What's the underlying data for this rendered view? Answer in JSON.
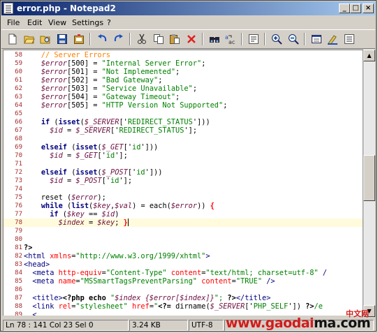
{
  "window": {
    "title": "error.php - Notepad2"
  },
  "menu": [
    "File",
    "Edit",
    "View",
    "Settings",
    "?"
  ],
  "toolbar_icons": [
    "new-icon",
    "open-icon",
    "browse-icon",
    "save-icon",
    "save-copy-icon",
    "undo-icon",
    "redo-icon",
    "cut-icon",
    "copy-icon",
    "paste-icon",
    "delete-icon",
    "find-icon",
    "replace-icon",
    "word-wrap-icon",
    "zoom-in-icon",
    "zoom-out-icon",
    "scheme-icon",
    "customize-icon",
    "exit-icon"
  ],
  "code_lines": [
    {
      "n": "58",
      "segs": [
        {
          "t": "    // Server Errors",
          "c": "#ff8000"
        }
      ]
    },
    {
      "n": "59",
      "segs": [
        {
          "t": "    ",
          "c": "#000"
        },
        {
          "t": "$error",
          "c": "#6d1040",
          "i": true
        },
        {
          "t": "[500] = ",
          "c": "#000"
        },
        {
          "t": "\"Internal Server Error\"",
          "c": "#008000"
        },
        {
          "t": ";",
          "c": "#000"
        }
      ]
    },
    {
      "n": "60",
      "segs": [
        {
          "t": "    ",
          "c": "#000"
        },
        {
          "t": "$error",
          "c": "#6d1040",
          "i": true
        },
        {
          "t": "[501] = ",
          "c": "#000"
        },
        {
          "t": "\"Not Implemented\"",
          "c": "#008000"
        },
        {
          "t": ";",
          "c": "#000"
        }
      ]
    },
    {
      "n": "61",
      "segs": [
        {
          "t": "    ",
          "c": "#000"
        },
        {
          "t": "$error",
          "c": "#6d1040",
          "i": true
        },
        {
          "t": "[502] = ",
          "c": "#000"
        },
        {
          "t": "\"Bad Gateway\"",
          "c": "#008000"
        },
        {
          "t": ";",
          "c": "#000"
        }
      ]
    },
    {
      "n": "62",
      "segs": [
        {
          "t": "    ",
          "c": "#000"
        },
        {
          "t": "$error",
          "c": "#6d1040",
          "i": true
        },
        {
          "t": "[503] = ",
          "c": "#000"
        },
        {
          "t": "\"Service Unavailable\"",
          "c": "#008000"
        },
        {
          "t": ";",
          "c": "#000"
        }
      ]
    },
    {
      "n": "63",
      "segs": [
        {
          "t": "    ",
          "c": "#000"
        },
        {
          "t": "$error",
          "c": "#6d1040",
          "i": true
        },
        {
          "t": "[504] = ",
          "c": "#000"
        },
        {
          "t": "\"Gateway Timeout\"",
          "c": "#008000"
        },
        {
          "t": ";",
          "c": "#000"
        }
      ]
    },
    {
      "n": "64",
      "segs": [
        {
          "t": "    ",
          "c": "#000"
        },
        {
          "t": "$error",
          "c": "#6d1040",
          "i": true
        },
        {
          "t": "[505] = ",
          "c": "#000"
        },
        {
          "t": "\"HTTP Version Not Supported\"",
          "c": "#008000"
        },
        {
          "t": ";",
          "c": "#000"
        }
      ]
    },
    {
      "n": "65",
      "segs": []
    },
    {
      "n": "66",
      "segs": [
        {
          "t": "    ",
          "c": "#000"
        },
        {
          "t": "if",
          "c": "#000080",
          "b": true
        },
        {
          "t": " (",
          "c": "#000"
        },
        {
          "t": "isset",
          "c": "#000080",
          "b": true
        },
        {
          "t": "(",
          "c": "#000"
        },
        {
          "t": "$_SERVER",
          "c": "#6d1040",
          "i": true
        },
        {
          "t": "['",
          "c": "#000"
        },
        {
          "t": "REDIRECT_STATUS",
          "c": "#008000"
        },
        {
          "t": "']))",
          "c": "#000"
        }
      ]
    },
    {
      "n": "67",
      "segs": [
        {
          "t": "      ",
          "c": "#000"
        },
        {
          "t": "$id",
          "c": "#6d1040",
          "i": true
        },
        {
          "t": " = ",
          "c": "#000"
        },
        {
          "t": "$_SERVER",
          "c": "#6d1040",
          "i": true
        },
        {
          "t": "['",
          "c": "#000"
        },
        {
          "t": "REDIRECT_STATUS",
          "c": "#008000"
        },
        {
          "t": "'];",
          "c": "#000"
        }
      ]
    },
    {
      "n": "68",
      "segs": []
    },
    {
      "n": "69",
      "segs": [
        {
          "t": "    ",
          "c": "#000"
        },
        {
          "t": "elseif",
          "c": "#000080",
          "b": true
        },
        {
          "t": " (",
          "c": "#000"
        },
        {
          "t": "isset",
          "c": "#000080",
          "b": true
        },
        {
          "t": "(",
          "c": "#000"
        },
        {
          "t": "$_GET",
          "c": "#6d1040",
          "i": true
        },
        {
          "t": "['",
          "c": "#000"
        },
        {
          "t": "id",
          "c": "#008000"
        },
        {
          "t": "']))",
          "c": "#000"
        }
      ]
    },
    {
      "n": "70",
      "segs": [
        {
          "t": "      ",
          "c": "#000"
        },
        {
          "t": "$id",
          "c": "#6d1040",
          "i": true
        },
        {
          "t": " = ",
          "c": "#000"
        },
        {
          "t": "$_GET",
          "c": "#6d1040",
          "i": true
        },
        {
          "t": "['",
          "c": "#000"
        },
        {
          "t": "id",
          "c": "#008000"
        },
        {
          "t": "'];",
          "c": "#000"
        }
      ]
    },
    {
      "n": "71",
      "segs": []
    },
    {
      "n": "72",
      "segs": [
        {
          "t": "    ",
          "c": "#000"
        },
        {
          "t": "elseif",
          "c": "#000080",
          "b": true
        },
        {
          "t": " (",
          "c": "#000"
        },
        {
          "t": "isset",
          "c": "#000080",
          "b": true
        },
        {
          "t": "(",
          "c": "#000"
        },
        {
          "t": "$_POST",
          "c": "#6d1040",
          "i": true
        },
        {
          "t": "['",
          "c": "#000"
        },
        {
          "t": "id",
          "c": "#008000"
        },
        {
          "t": "']))",
          "c": "#000"
        }
      ]
    },
    {
      "n": "73",
      "segs": [
        {
          "t": "      ",
          "c": "#000"
        },
        {
          "t": "$id",
          "c": "#6d1040",
          "i": true
        },
        {
          "t": " = ",
          "c": "#000"
        },
        {
          "t": "$_POST",
          "c": "#6d1040",
          "i": true
        },
        {
          "t": "['",
          "c": "#000"
        },
        {
          "t": "id",
          "c": "#008000"
        },
        {
          "t": "'];",
          "c": "#000"
        }
      ]
    },
    {
      "n": "74",
      "segs": []
    },
    {
      "n": "75",
      "segs": [
        {
          "t": "    reset (",
          "c": "#000"
        },
        {
          "t": "$error",
          "c": "#6d1040",
          "i": true
        },
        {
          "t": ");",
          "c": "#000"
        }
      ]
    },
    {
      "n": "76",
      "segs": [
        {
          "t": "    ",
          "c": "#000"
        },
        {
          "t": "while",
          "c": "#000080",
          "b": true
        },
        {
          "t": " (",
          "c": "#000"
        },
        {
          "t": "list",
          "c": "#000080",
          "b": true
        },
        {
          "t": "(",
          "c": "#000"
        },
        {
          "t": "$key",
          "c": "#6d1040",
          "i": true
        },
        {
          "t": ",",
          "c": "#000"
        },
        {
          "t": "$val",
          "c": "#6d1040",
          "i": true
        },
        {
          "t": ") = each(",
          "c": "#000"
        },
        {
          "t": "$error",
          "c": "#6d1040",
          "i": true
        },
        {
          "t": ")) ",
          "c": "#000"
        },
        {
          "t": "{",
          "c": "#ff0000",
          "b": true
        }
      ]
    },
    {
      "n": "77",
      "segs": [
        {
          "t": "      ",
          "c": "#000"
        },
        {
          "t": "if",
          "c": "#000080",
          "b": true
        },
        {
          "t": " (",
          "c": "#000"
        },
        {
          "t": "$key",
          "c": "#6d1040",
          "i": true
        },
        {
          "t": " == ",
          "c": "#000"
        },
        {
          "t": "$id",
          "c": "#6d1040",
          "i": true
        },
        {
          "t": ")",
          "c": "#000"
        }
      ]
    },
    {
      "n": "78",
      "cur": true,
      "segs": [
        {
          "t": "        ",
          "c": "#000"
        },
        {
          "t": "$index",
          "c": "#6d1040",
          "i": true
        },
        {
          "t": " = ",
          "c": "#000"
        },
        {
          "t": "$key",
          "c": "#6d1040",
          "i": true
        },
        {
          "t": "; ",
          "c": "#000"
        },
        {
          "t": "}",
          "c": "#ff0000",
          "b": true
        }
      ]
    },
    {
      "n": "79",
      "segs": []
    },
    {
      "n": "80",
      "segs": []
    },
    {
      "n": "81",
      "segs": [
        {
          "t": "?>",
          "c": "#000",
          "b": true
        }
      ]
    },
    {
      "n": "82",
      "segs": [
        {
          "t": "<html ",
          "c": "#000080"
        },
        {
          "t": "xmlns",
          "c": "#ff0000"
        },
        {
          "t": "=",
          "c": "#000"
        },
        {
          "t": "\"http://www.w3.org/1999/xhtml\"",
          "c": "#008000"
        },
        {
          "t": ">",
          "c": "#000080"
        }
      ]
    },
    {
      "n": "83",
      "segs": [
        {
          "t": "<head>",
          "c": "#000080"
        }
      ]
    },
    {
      "n": "84",
      "segs": [
        {
          "t": "  <meta ",
          "c": "#000080"
        },
        {
          "t": "http-equiv",
          "c": "#ff0000"
        },
        {
          "t": "=",
          "c": "#000"
        },
        {
          "t": "\"Content-Type\"",
          "c": "#008000"
        },
        {
          "t": " ",
          "c": "#000"
        },
        {
          "t": "content",
          "c": "#ff0000"
        },
        {
          "t": "=",
          "c": "#000"
        },
        {
          "t": "\"text/html; charset=utf-8\"",
          "c": "#008000"
        },
        {
          "t": " /",
          "c": "#000080"
        }
      ]
    },
    {
      "n": "85",
      "segs": [
        {
          "t": "  <meta ",
          "c": "#000080"
        },
        {
          "t": "name",
          "c": "#ff0000"
        },
        {
          "t": "=",
          "c": "#000"
        },
        {
          "t": "\"MSSmartTagsPreventParsing\"",
          "c": "#008000"
        },
        {
          "t": " ",
          "c": "#000"
        },
        {
          "t": "content",
          "c": "#ff0000"
        },
        {
          "t": "=",
          "c": "#000"
        },
        {
          "t": "\"TRUE\"",
          "c": "#008000"
        },
        {
          "t": " />",
          "c": "#000080"
        }
      ]
    },
    {
      "n": "86",
      "segs": []
    },
    {
      "n": "87",
      "segs": [
        {
          "t": "  <title>",
          "c": "#000080"
        },
        {
          "t": "<?php echo ",
          "c": "#000",
          "b": true
        },
        {
          "t": "\"",
          "c": "#008000"
        },
        {
          "t": "$index {$error[$index]}",
          "c": "#6d1040",
          "i": true
        },
        {
          "t": "\";",
          "c": "#008000"
        },
        {
          "t": " ?>",
          "c": "#000",
          "b": true
        },
        {
          "t": "</title>",
          "c": "#000080"
        }
      ]
    },
    {
      "n": "88",
      "segs": [
        {
          "t": "  <link ",
          "c": "#000080"
        },
        {
          "t": "rel",
          "c": "#ff0000"
        },
        {
          "t": "=",
          "c": "#000"
        },
        {
          "t": "\"stylesheet\"",
          "c": "#008000"
        },
        {
          "t": " ",
          "c": "#000"
        },
        {
          "t": "href",
          "c": "#ff0000"
        },
        {
          "t": "=",
          "c": "#000"
        },
        {
          "t": "\"",
          "c": "#008000"
        },
        {
          "t": "<?= ",
          "c": "#000",
          "b": true
        },
        {
          "t": "dirname(",
          "c": "#000"
        },
        {
          "t": "$_SERVER",
          "c": "#6d1040",
          "i": true
        },
        {
          "t": "['",
          "c": "#000"
        },
        {
          "t": "PHP_SELF",
          "c": "#008000"
        },
        {
          "t": "'])",
          "c": "#000"
        },
        {
          "t": " ?>",
          "c": "#000",
          "b": true
        },
        {
          "t": "/e",
          "c": "#008000"
        }
      ]
    },
    {
      "n": "89",
      "segs": [
        {
          "t": "  <",
          "c": "#000080"
        }
      ]
    }
  ],
  "status": {
    "position": "Ln 78 : 141  Col 23  Sel 0",
    "size": "3.24 KB",
    "encoding": "UTF-8"
  },
  "watermark": {
    "cn": "中文网",
    "url_red": "www.gaodai",
    "url_black": "ma",
    "url_tail": ".com"
  }
}
